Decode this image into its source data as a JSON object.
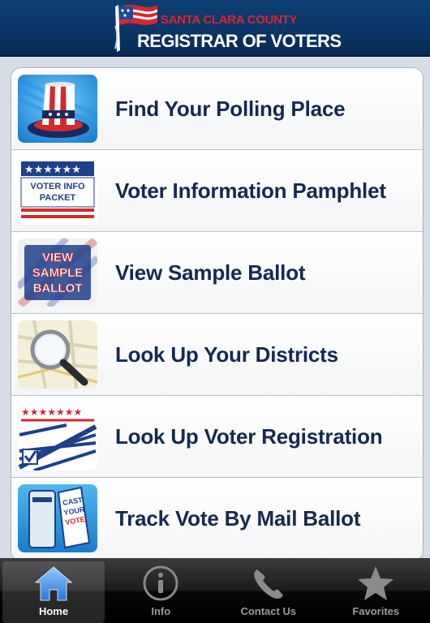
{
  "header": {
    "county": "Santa Clara County",
    "title": "Registrar of Voters"
  },
  "menu": {
    "items": [
      {
        "label": "Find Your Polling Place",
        "icon": "uncle-sam-hat-icon"
      },
      {
        "label": "Voter Information Pamphlet",
        "icon": "voter-info-packet-icon",
        "icon_text": [
          "VOTER INFO",
          "PACKET"
        ]
      },
      {
        "label": "View Sample Ballot",
        "icon": "sample-ballot-icon",
        "icon_text": [
          "VIEW",
          "SAMPLE",
          "BALLOT"
        ]
      },
      {
        "label": "Look Up Your Districts",
        "icon": "magnifier-map-icon"
      },
      {
        "label": "Look Up Voter Registration",
        "icon": "registration-form-icon"
      },
      {
        "label": "Track Vote By Mail Ballot",
        "icon": "mail-ballot-icon",
        "icon_text": [
          "CAST",
          "YOUR",
          "VOTE"
        ]
      }
    ]
  },
  "tabbar": {
    "tabs": [
      {
        "label": "Home",
        "icon": "home-icon",
        "active": true
      },
      {
        "label": "Info",
        "icon": "info-icon",
        "active": false
      },
      {
        "label": "Contact Us",
        "icon": "phone-icon",
        "active": false
      },
      {
        "label": "Favorites",
        "icon": "star-icon",
        "active": false
      }
    ]
  },
  "colors": {
    "header_blue": "#0b3566",
    "label_navy": "#16294d",
    "flag_red": "#d8262e",
    "tab_active": "#4a90d9"
  }
}
